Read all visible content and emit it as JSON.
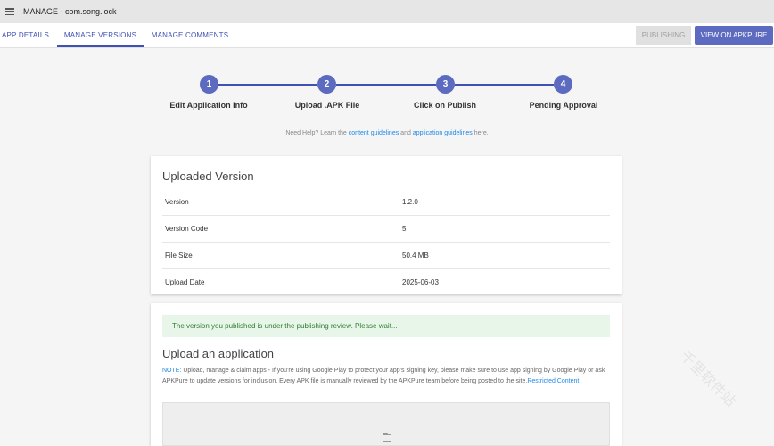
{
  "header": {
    "title": "MANAGE - com.song.lock",
    "menu_icon": "hamburger-menu-icon"
  },
  "tabs": [
    {
      "label": "APP DETAILS",
      "active": false
    },
    {
      "label": "MANAGE VERSIONS",
      "active": true
    },
    {
      "label": "MANAGE COMMENTS",
      "active": false
    }
  ],
  "actions": {
    "publishing_label": "PUBLISHING",
    "view_label": "VIEW ON APKPURE"
  },
  "colors": {
    "primary": "#3f51b5",
    "accent": "#5c6bc0",
    "link": "#1e88e5",
    "success_bg": "#e8f5e9",
    "success_text": "#2e7d32"
  },
  "steps": [
    {
      "number": "1",
      "label": "Edit Application Info"
    },
    {
      "number": "2",
      "label": "Upload .APK File"
    },
    {
      "number": "3",
      "label": "Click on Publish"
    },
    {
      "number": "4",
      "label": "Pending Approval"
    }
  ],
  "help": {
    "prefix": "Need Help? Learn the",
    "link1": "content guidelines",
    "middle": "and",
    "link2": "application guidelines",
    "suffix": "here."
  },
  "uploaded": {
    "title": "Uploaded Version",
    "rows": [
      {
        "key": "Version",
        "value": "1.2.0"
      },
      {
        "key": "Version Code",
        "value": "5"
      },
      {
        "key": "File Size",
        "value": "50.4 MB"
      },
      {
        "key": "Upload Date",
        "value": "2025-06-03"
      }
    ]
  },
  "upload_app": {
    "notice": "The version you published is under the publishing review. Please wait...",
    "title": "Upload an application",
    "note_label": "NOTE:",
    "note_text": "Upload, manage & claim apps - If you're using Google Play to protect your app's signing key, please make sure to use app signing by Google Play or ask APKPure to update versions for inclusion. Every APK file is manually reviewed by the APKPure team before being posted to the site.",
    "note_link": "Restricted Content",
    "dropzone_icon": "folder-icon"
  },
  "watermark": {
    "text": "千里软件站"
  }
}
